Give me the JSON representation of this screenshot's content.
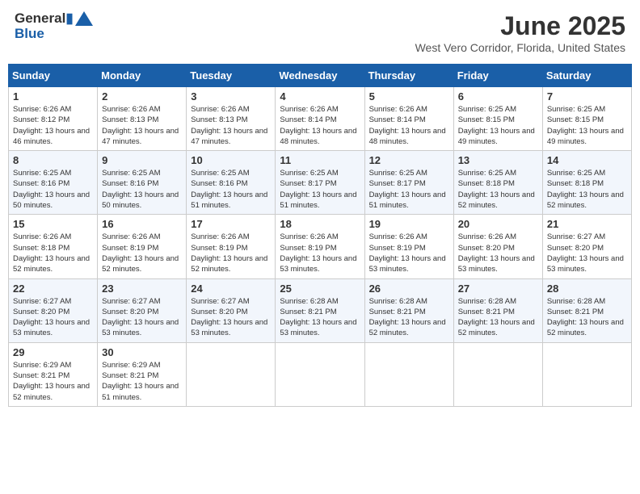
{
  "header": {
    "logo_line1": "General",
    "logo_line2": "Blue",
    "month_year": "June 2025",
    "location": "West Vero Corridor, Florida, United States"
  },
  "weekdays": [
    "Sunday",
    "Monday",
    "Tuesday",
    "Wednesday",
    "Thursday",
    "Friday",
    "Saturday"
  ],
  "weeks": [
    [
      {
        "day": 1,
        "sunrise": "6:26 AM",
        "sunset": "8:12 PM",
        "daylight": "13 hours and 46 minutes."
      },
      {
        "day": 2,
        "sunrise": "6:26 AM",
        "sunset": "8:13 PM",
        "daylight": "13 hours and 47 minutes."
      },
      {
        "day": 3,
        "sunrise": "6:26 AM",
        "sunset": "8:13 PM",
        "daylight": "13 hours and 47 minutes."
      },
      {
        "day": 4,
        "sunrise": "6:26 AM",
        "sunset": "8:14 PM",
        "daylight": "13 hours and 48 minutes."
      },
      {
        "day": 5,
        "sunrise": "6:26 AM",
        "sunset": "8:14 PM",
        "daylight": "13 hours and 48 minutes."
      },
      {
        "day": 6,
        "sunrise": "6:25 AM",
        "sunset": "8:15 PM",
        "daylight": "13 hours and 49 minutes."
      },
      {
        "day": 7,
        "sunrise": "6:25 AM",
        "sunset": "8:15 PM",
        "daylight": "13 hours and 49 minutes."
      }
    ],
    [
      {
        "day": 8,
        "sunrise": "6:25 AM",
        "sunset": "8:16 PM",
        "daylight": "13 hours and 50 minutes."
      },
      {
        "day": 9,
        "sunrise": "6:25 AM",
        "sunset": "8:16 PM",
        "daylight": "13 hours and 50 minutes."
      },
      {
        "day": 10,
        "sunrise": "6:25 AM",
        "sunset": "8:16 PM",
        "daylight": "13 hours and 51 minutes."
      },
      {
        "day": 11,
        "sunrise": "6:25 AM",
        "sunset": "8:17 PM",
        "daylight": "13 hours and 51 minutes."
      },
      {
        "day": 12,
        "sunrise": "6:25 AM",
        "sunset": "8:17 PM",
        "daylight": "13 hours and 51 minutes."
      },
      {
        "day": 13,
        "sunrise": "6:25 AM",
        "sunset": "8:18 PM",
        "daylight": "13 hours and 52 minutes."
      },
      {
        "day": 14,
        "sunrise": "6:25 AM",
        "sunset": "8:18 PM",
        "daylight": "13 hours and 52 minutes."
      }
    ],
    [
      {
        "day": 15,
        "sunrise": "6:26 AM",
        "sunset": "8:18 PM",
        "daylight": "13 hours and 52 minutes."
      },
      {
        "day": 16,
        "sunrise": "6:26 AM",
        "sunset": "8:19 PM",
        "daylight": "13 hours and 52 minutes."
      },
      {
        "day": 17,
        "sunrise": "6:26 AM",
        "sunset": "8:19 PM",
        "daylight": "13 hours and 52 minutes."
      },
      {
        "day": 18,
        "sunrise": "6:26 AM",
        "sunset": "8:19 PM",
        "daylight": "13 hours and 53 minutes."
      },
      {
        "day": 19,
        "sunrise": "6:26 AM",
        "sunset": "8:19 PM",
        "daylight": "13 hours and 53 minutes."
      },
      {
        "day": 20,
        "sunrise": "6:26 AM",
        "sunset": "8:20 PM",
        "daylight": "13 hours and 53 minutes."
      },
      {
        "day": 21,
        "sunrise": "6:27 AM",
        "sunset": "8:20 PM",
        "daylight": "13 hours and 53 minutes."
      }
    ],
    [
      {
        "day": 22,
        "sunrise": "6:27 AM",
        "sunset": "8:20 PM",
        "daylight": "13 hours and 53 minutes."
      },
      {
        "day": 23,
        "sunrise": "6:27 AM",
        "sunset": "8:20 PM",
        "daylight": "13 hours and 53 minutes."
      },
      {
        "day": 24,
        "sunrise": "6:27 AM",
        "sunset": "8:20 PM",
        "daylight": "13 hours and 53 minutes."
      },
      {
        "day": 25,
        "sunrise": "6:28 AM",
        "sunset": "8:21 PM",
        "daylight": "13 hours and 53 minutes."
      },
      {
        "day": 26,
        "sunrise": "6:28 AM",
        "sunset": "8:21 PM",
        "daylight": "13 hours and 52 minutes."
      },
      {
        "day": 27,
        "sunrise": "6:28 AM",
        "sunset": "8:21 PM",
        "daylight": "13 hours and 52 minutes."
      },
      {
        "day": 28,
        "sunrise": "6:28 AM",
        "sunset": "8:21 PM",
        "daylight": "13 hours and 52 minutes."
      }
    ],
    [
      {
        "day": 29,
        "sunrise": "6:29 AM",
        "sunset": "8:21 PM",
        "daylight": "13 hours and 52 minutes."
      },
      {
        "day": 30,
        "sunrise": "6:29 AM",
        "sunset": "8:21 PM",
        "daylight": "13 hours and 51 minutes."
      },
      null,
      null,
      null,
      null,
      null
    ]
  ]
}
